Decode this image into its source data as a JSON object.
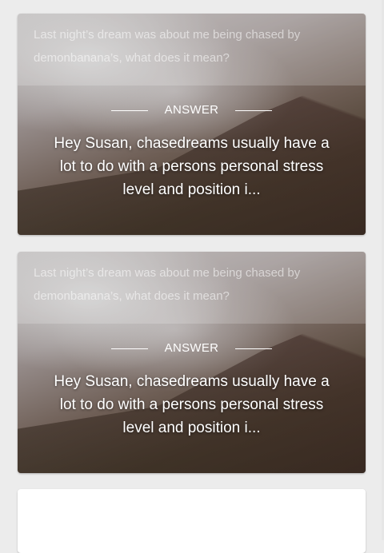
{
  "cards": [
    {
      "question": "Last night’s dream was about me being chased by demonbanana’s, what does it mean?",
      "answer_label": "ANSWER",
      "answer": "Hey Susan, chasedreams usually have a lot to do with a persons personal stress level and position i..."
    },
    {
      "question": "Last night’s dream was about me being chased by demonbanana’s, what does it mean?",
      "answer_label": "ANSWER",
      "answer": "Hey Susan, chasedreams usually have a lot to do with a persons personal stress level and position i..."
    }
  ]
}
